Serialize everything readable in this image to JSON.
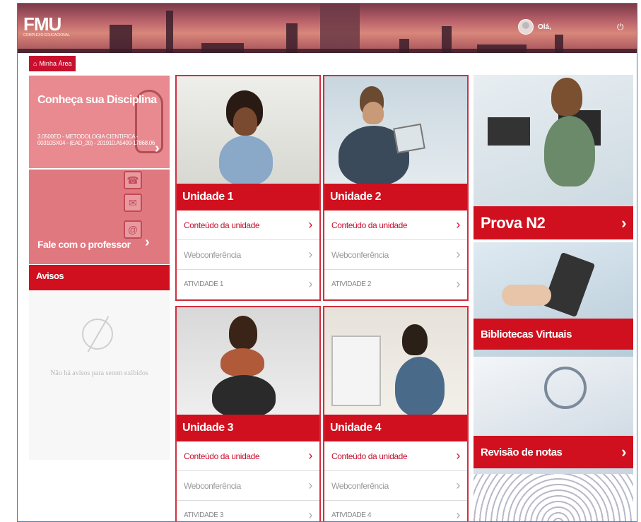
{
  "header": {
    "logo": "FMU",
    "logo_sub": "COMPLEXO EDUCACIONAL",
    "greeting": "Olá,",
    "power_icon": "power-icon"
  },
  "breadcrumb": {
    "label": "Minha Área",
    "icon": "home-icon"
  },
  "discipline_card": {
    "title": "Conheça sua Disciplina",
    "code": "3.0500ED - METODOLOGIA CIENTIFICA - 00310SX04 - (EAD_20) - 201910.A5400-17868.06"
  },
  "professor_card": {
    "title": "Fale com o professor"
  },
  "avisos": {
    "title": "Avisos",
    "empty_message": "Não há avisos para serem exibidos"
  },
  "units": [
    {
      "title": "Unidade 1",
      "content": "Conteúdo da unidade",
      "webconf": "Webconferência",
      "activity": "ATIVIDADE 1"
    },
    {
      "title": "Unidade 2",
      "content": "Conteúdo da unidade",
      "webconf": "Webconferência",
      "activity": "ATIVIDADE 2"
    },
    {
      "title": "Unidade 3",
      "content": "Conteúdo da unidade",
      "webconf": "Webconferência",
      "activity": "ATIVIDADE 3"
    },
    {
      "title": "Unidade 4",
      "content": "Conteúdo da unidade",
      "webconf": "Webconferência",
      "activity": "ATIVIDADE 4"
    }
  ],
  "right": {
    "prova": "Prova N2",
    "bibliotecas": "Bibliotecas Virtuais",
    "revisao": "Revisão de notas"
  },
  "colors": {
    "brand_red": "#d0101e",
    "header": "#b9626a"
  }
}
